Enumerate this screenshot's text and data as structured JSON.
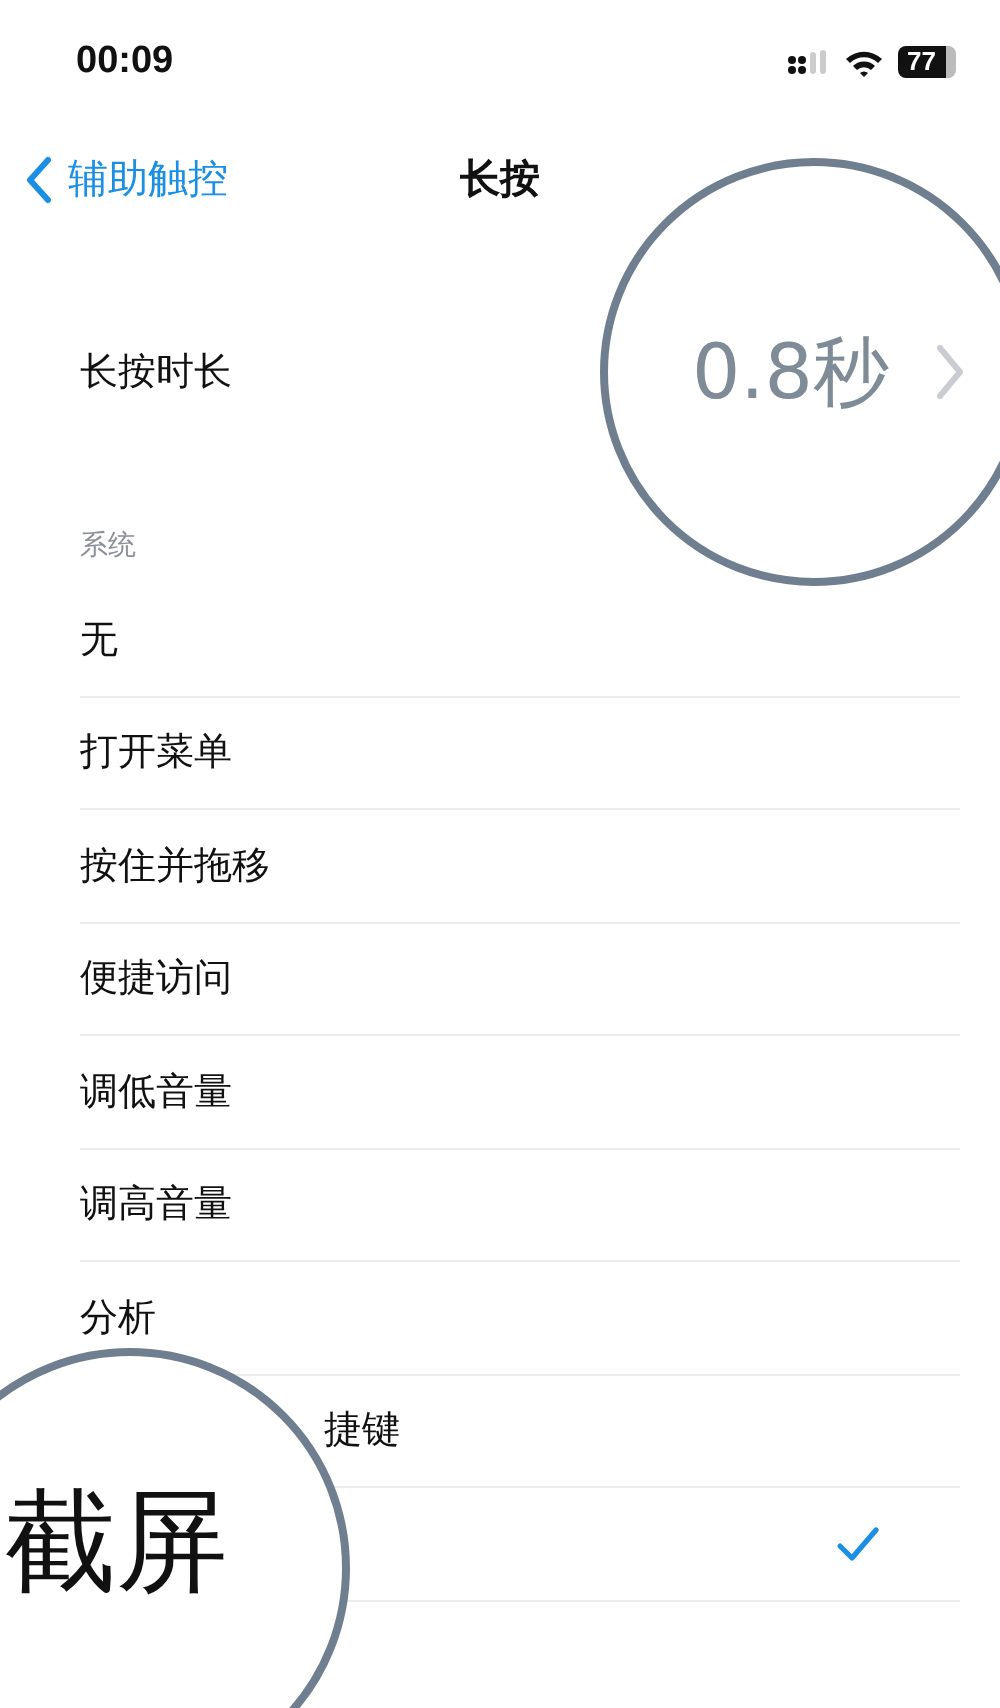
{
  "status_bar": {
    "time": "00:09",
    "battery": "77"
  },
  "nav": {
    "back": "辅助触控",
    "title": "长按"
  },
  "duration": {
    "label": "长按时长",
    "value": "0.8秒"
  },
  "section": {
    "header": "系统"
  },
  "items": [
    {
      "label": "无",
      "kind": "plain",
      "selected": false
    },
    {
      "label": "打开菜单",
      "kind": "plain",
      "selected": false
    },
    {
      "label": "按住并拖移",
      "kind": "plain",
      "selected": false
    },
    {
      "label": "便捷访问",
      "kind": "plain",
      "selected": false
    },
    {
      "label": "调低音量",
      "kind": "plain",
      "selected": false
    },
    {
      "label": "调高音量",
      "kind": "plain",
      "selected": false
    },
    {
      "label": "分析",
      "kind": "plain",
      "selected": false
    },
    {
      "label": "捷键",
      "kind": "partly_hidden",
      "selected": false
    },
    {
      "label": "截屏",
      "kind": "magnified",
      "selected": true
    }
  ]
}
